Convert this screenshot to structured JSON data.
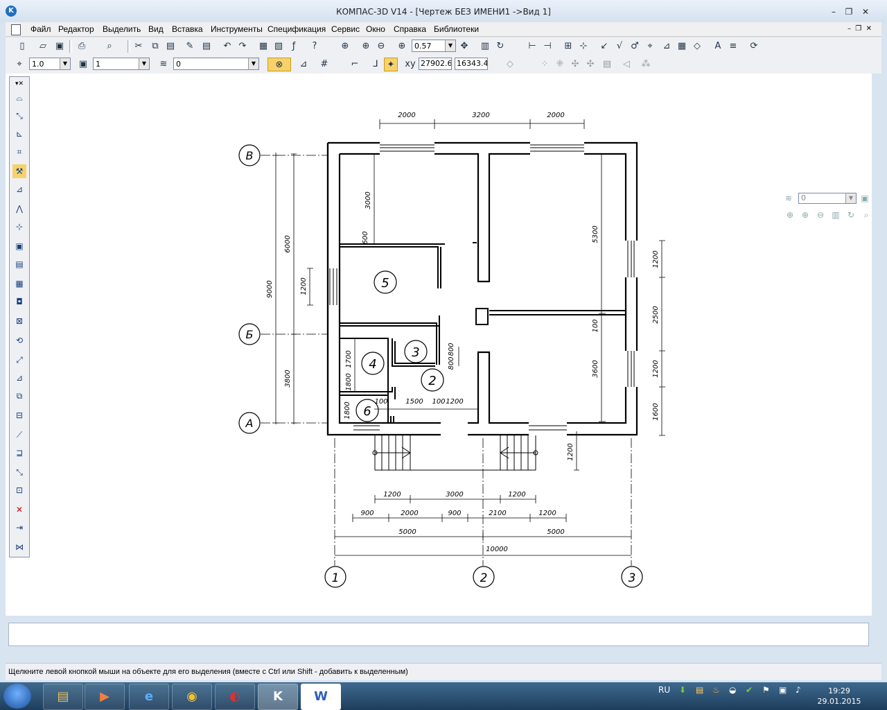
{
  "window": {
    "title": "КОМПАС-3D V14 - [Чертеж БЕЗ ИМЕНИ1 ->Вид 1]",
    "app_icon": "kompas-logo-icon"
  },
  "menu": [
    "Файл",
    "Редактор",
    "Выделить",
    "Вид",
    "Вставка",
    "Инструменты",
    "Спецификация",
    "Сервис",
    "Окно",
    "Справка",
    "Библиотеки"
  ],
  "toolbar1": {
    "zoom_value": "0.57"
  },
  "toolbar2": {
    "line_scale": "1.0",
    "layer": "1",
    "style": "0",
    "coord_x": "27902.6",
    "coord_y": "16343.4"
  },
  "right_panel": {
    "layer_value": "0"
  },
  "drawing": {
    "axes_letters": [
      "В",
      "Б",
      "А"
    ],
    "axes_numbers": [
      "1",
      "2",
      "3"
    ],
    "rooms": [
      "5",
      "3",
      "4",
      "2",
      "6"
    ],
    "dims_top": [
      "2000",
      "3200",
      "2000"
    ],
    "dims_left": [
      "6000",
      "9000",
      "1200",
      "3000",
      "600",
      "3800",
      "1700",
      "1800",
      "1800",
      "100"
    ],
    "dims_inner": [
      "5300",
      "100",
      "3600",
      "800",
      "800",
      "1500",
      "100",
      "1200",
      "100",
      "1200"
    ],
    "dims_right": [
      "1200",
      "2500",
      "1200",
      "1600"
    ],
    "dims_bottom1": [
      "1200",
      "3000",
      "1200"
    ],
    "dims_bottom2": [
      "900",
      "2000",
      "900",
      "2100",
      "1200"
    ],
    "dims_bottom3": [
      "5000",
      "5000"
    ],
    "dims_total": "10000"
  },
  "status": {
    "hint": "Щелкните левой кнопкой мыши на объекте для его выделения (вместе с Ctrl или Shift - добавить к выделенным)"
  },
  "taskbar": {
    "lang": "RU",
    "time": "19:29",
    "date": "29.01.2015"
  }
}
